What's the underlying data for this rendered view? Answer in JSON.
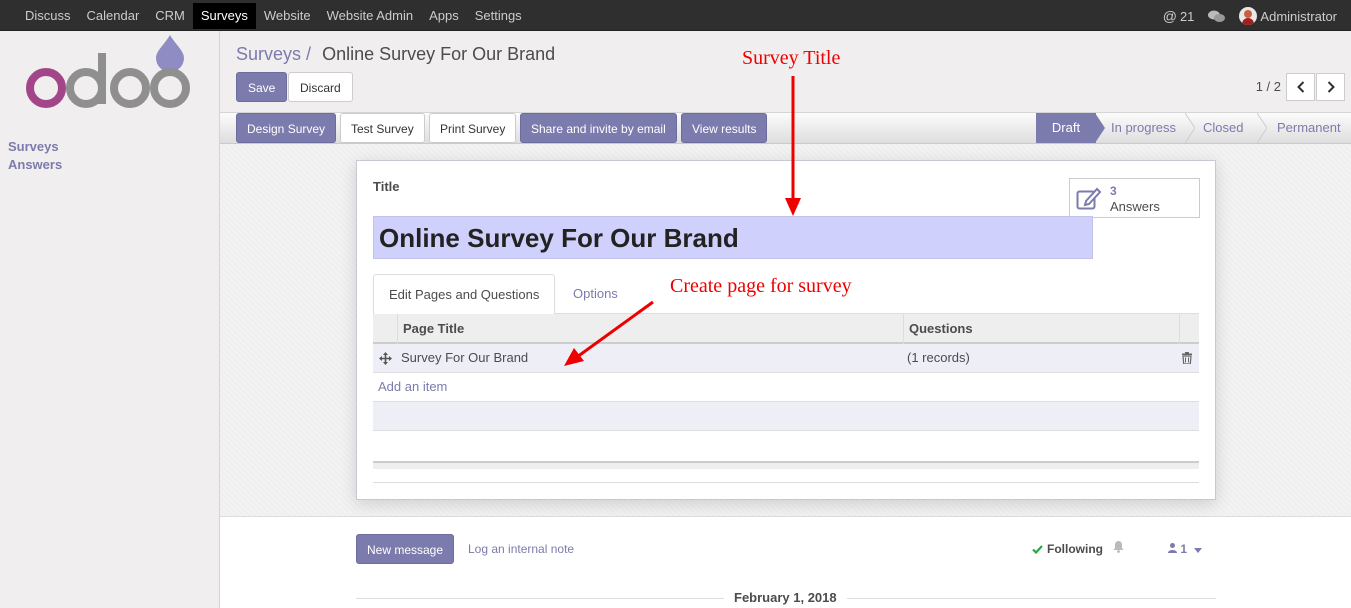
{
  "navbar": {
    "menu": [
      "Discuss",
      "Calendar",
      "CRM",
      "Surveys",
      "Website",
      "Website Admin",
      "Apps",
      "Settings"
    ],
    "active": "Surveys",
    "mentions_count": "21",
    "user": "Administrator"
  },
  "sidebar": {
    "brand": "odoo",
    "items": [
      "Surveys",
      "Answers"
    ]
  },
  "control_panel": {
    "breadcrumb_parent": "Surveys",
    "breadcrumb_sep": "/",
    "breadcrumb_current": "Online Survey For Our Brand",
    "save_label": "Save",
    "discard_label": "Discard",
    "pager": "1 / 2"
  },
  "header": {
    "buttons": [
      "Design Survey",
      "Test Survey",
      "Print Survey",
      "Share and invite by email",
      "View results"
    ],
    "stages": [
      "Draft",
      "In progress",
      "Closed",
      "Permanent"
    ],
    "active_stage": "Draft"
  },
  "form": {
    "title_label": "Title",
    "title_value": "Online Survey For Our Brand",
    "stat_count": "3",
    "stat_label": "Answers",
    "tabs": [
      "Edit Pages and Questions",
      "Options"
    ],
    "table": {
      "columns": [
        "Page Title",
        "Questions"
      ],
      "rows": [
        {
          "page_title": "Survey For Our Brand",
          "questions": "(1 records)"
        }
      ],
      "add_item": "Add an item"
    }
  },
  "chatter": {
    "new_message": "New message",
    "log_note": "Log an internal note",
    "following": "Following",
    "followers_count": "1",
    "date": "February 1, 2018"
  },
  "annotations": {
    "survey_title": "Survey Title",
    "create_page": "Create page for survey",
    "color": "#e00000"
  },
  "colors": {
    "primary": "#7c7bad",
    "navbar": "#2f2f2f",
    "title_highlight": "#cfd0fb"
  }
}
